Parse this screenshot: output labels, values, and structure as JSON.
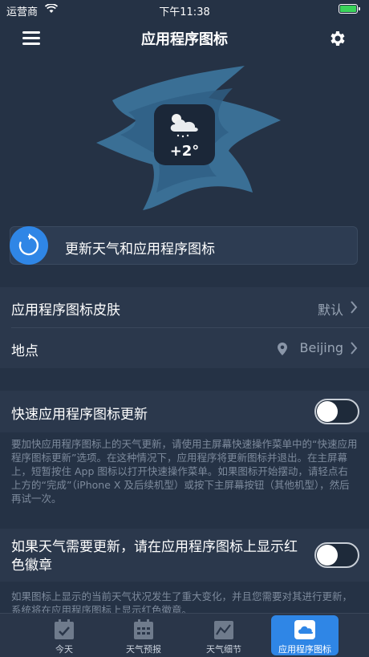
{
  "status_bar": {
    "carrier": "运营商",
    "time": "下午11:38"
  },
  "nav": {
    "title": "应用程序图标"
  },
  "hero": {
    "temperature": "+2°"
  },
  "update_button": {
    "label": "更新天气和应用程序图标"
  },
  "settings": {
    "skin": {
      "label": "应用程序图标皮肤",
      "value": "默认"
    },
    "location": {
      "label": "地点",
      "value": "Beijing"
    }
  },
  "quick_update": {
    "label": "快速应用程序图标更新",
    "enabled": false,
    "note": "要加快应用程序图标上的天气更新，请使用主屏幕快速操作菜单中的“快速应用程序图标更新”选项。在这种情况下，应用程序将更新图标并退出。在主屏幕上，短暂按住 App 图标以打开快速操作菜单。如果图标开始摆动，请轻点右上方的“完成”（iPhone X 及后续机型）或按下主屏幕按钮（其他机型），然后再试一次。"
  },
  "red_badge": {
    "label": "如果天气需要更新，请在应用程序图标上显示红色徽章",
    "enabled": false,
    "note": "如果图标上显示的当前天气状况发生了重大变化，并且您需要对其进行更新，系统将在应用程序图标上显示红色徽章。"
  },
  "tabs": [
    {
      "label": "今天",
      "icon": "calendar-check-icon",
      "active": false
    },
    {
      "label": "天气预报",
      "icon": "calendar-grid-icon",
      "active": false
    },
    {
      "label": "天气细节",
      "icon": "line-chart-icon",
      "active": false
    },
    {
      "label": "应用程序图标",
      "icon": "cloud-icon",
      "active": true
    }
  ],
  "colors": {
    "accent": "#2f86e6",
    "background": "#253245",
    "battery": "#3ad45a"
  }
}
